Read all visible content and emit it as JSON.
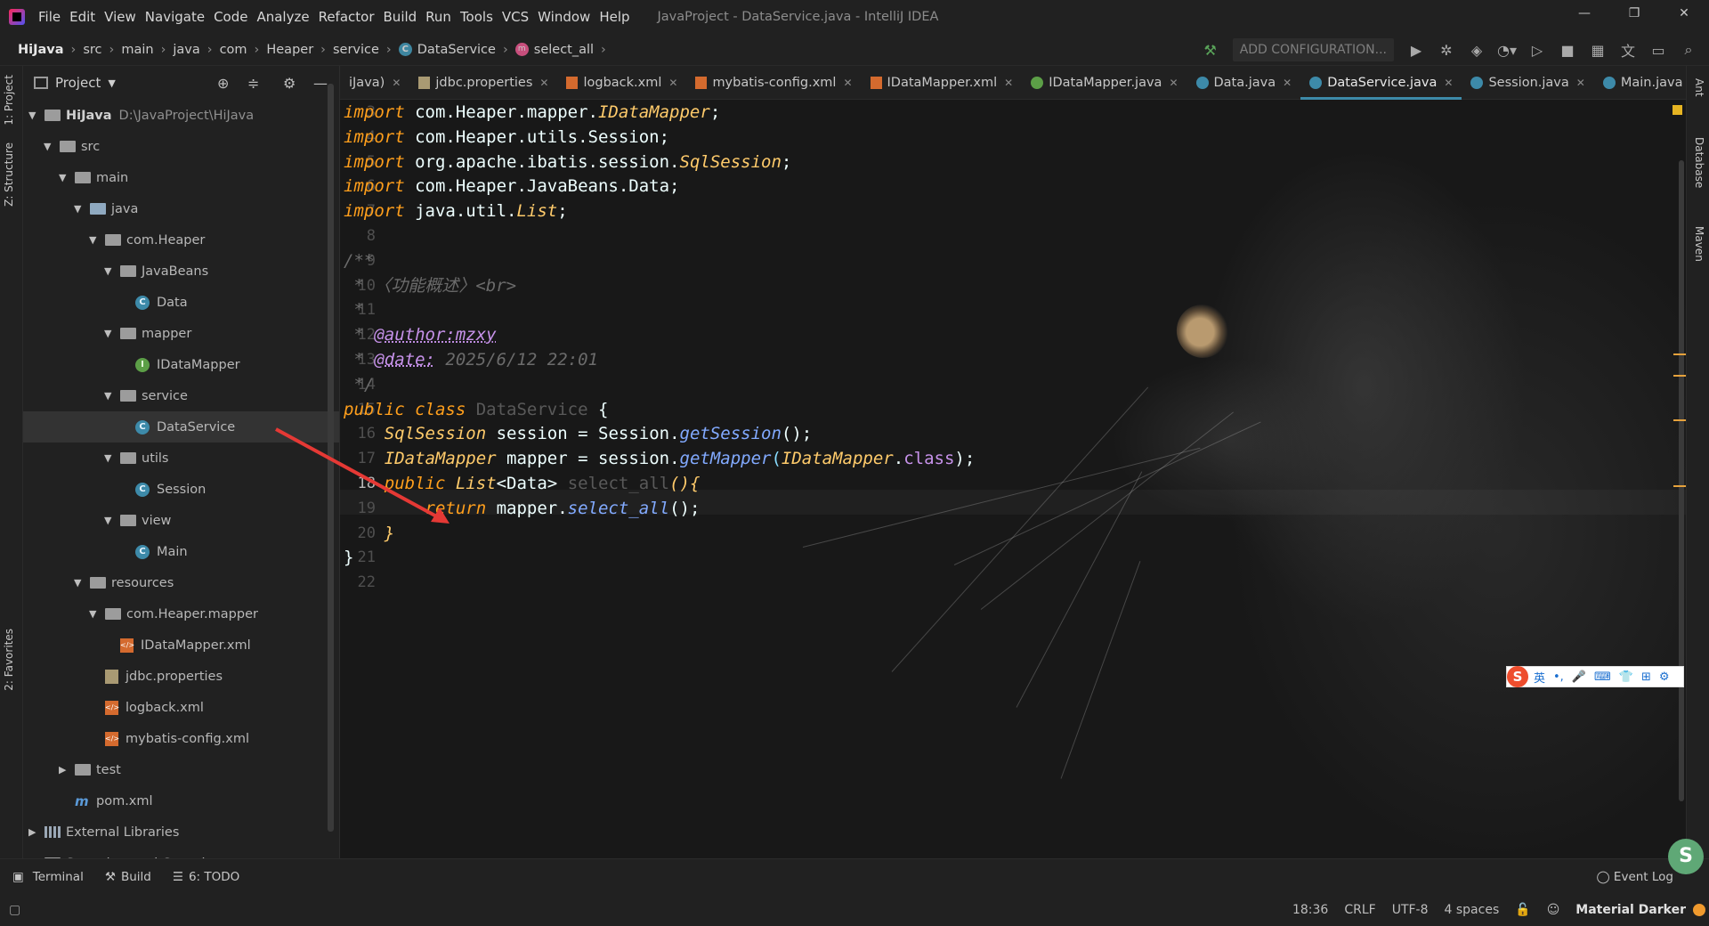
{
  "window": {
    "title": "JavaProject - DataService.java - IntelliJ IDEA",
    "controls": [
      "—",
      "❐",
      "✕"
    ]
  },
  "menu": [
    "File",
    "Edit",
    "View",
    "Navigate",
    "Code",
    "Analyze",
    "Refactor",
    "Build",
    "Run",
    "Tools",
    "VCS",
    "Window",
    "Help"
  ],
  "breadcrumbs": [
    "HiJava",
    "src",
    "main",
    "java",
    "com",
    "Heaper",
    "service",
    "DataService",
    "select_all"
  ],
  "toolbar": {
    "add_configuration": "ADD CONFIGURATION..."
  },
  "left_strip": {
    "project": "1: Project",
    "structure": "Z: Structure",
    "favorites": "2: Favorites"
  },
  "right_strip": {
    "ant": "Ant",
    "database": "Database",
    "maven": "Maven"
  },
  "project_panel": {
    "title": "Project",
    "tree": [
      {
        "label": "HiJava",
        "extra": "D:\\JavaProject\\HiJava",
        "icon": "module-folder-icon",
        "arrow": "▼"
      },
      {
        "label": "src",
        "icon": "folder-icon",
        "arrow": "▼"
      },
      {
        "label": "main",
        "icon": "folder-icon",
        "arrow": "▼"
      },
      {
        "label": "java",
        "icon": "source-folder-icon",
        "arrow": "▼"
      },
      {
        "label": "com.Heaper",
        "icon": "package-icon",
        "arrow": "▼"
      },
      {
        "label": "JavaBeans",
        "icon": "package-icon",
        "arrow": "▼"
      },
      {
        "label": "Data",
        "icon": "class-icon",
        "arrow": ""
      },
      {
        "label": "mapper",
        "icon": "package-icon",
        "arrow": "▼"
      },
      {
        "label": "IDataMapper",
        "icon": "interface-icon",
        "arrow": ""
      },
      {
        "label": "service",
        "icon": "package-icon",
        "arrow": "▼"
      },
      {
        "label": "DataService",
        "icon": "class-icon",
        "arrow": ""
      },
      {
        "label": "utils",
        "icon": "package-icon",
        "arrow": "▼"
      },
      {
        "label": "Session",
        "icon": "class-icon",
        "arrow": ""
      },
      {
        "label": "view",
        "icon": "package-icon",
        "arrow": "▼"
      },
      {
        "label": "Main",
        "icon": "class-icon",
        "arrow": ""
      },
      {
        "label": "resources",
        "icon": "resources-folder-icon",
        "arrow": "▼"
      },
      {
        "label": "com.Heaper.mapper",
        "icon": "folder-icon",
        "arrow": "▼"
      },
      {
        "label": "IDataMapper.xml",
        "icon": "xml-file-icon",
        "arrow": ""
      },
      {
        "label": "jdbc.properties",
        "icon": "properties-file-icon",
        "arrow": ""
      },
      {
        "label": "logback.xml",
        "icon": "xml-file-icon",
        "arrow": ""
      },
      {
        "label": "mybatis-config.xml",
        "icon": "xml-file-icon",
        "arrow": ""
      },
      {
        "label": "test",
        "icon": "folder-icon",
        "arrow": "▶"
      },
      {
        "label": "pom.xml",
        "icon": "maven-icon",
        "arrow": ""
      },
      {
        "label": "External Libraries",
        "icon": "library-icon",
        "arrow": "▶"
      },
      {
        "label": "Scratches and Consoles",
        "icon": "scratch-icon",
        "arrow": "▶"
      }
    ]
  },
  "tabs": [
    {
      "label": "iJava)",
      "icon": "none"
    },
    {
      "label": "jdbc.properties",
      "icon": "properties"
    },
    {
      "label": "logback.xml",
      "icon": "xml"
    },
    {
      "label": "mybatis-config.xml",
      "icon": "xml"
    },
    {
      "label": "IDataMapper.xml",
      "icon": "xml"
    },
    {
      "label": "IDataMapper.java",
      "icon": "interface"
    },
    {
      "label": "Data.java",
      "icon": "class"
    },
    {
      "label": "DataService.java",
      "icon": "class",
      "active": true
    },
    {
      "label": "Session.java",
      "icon": "class"
    },
    {
      "label": "Main.java",
      "icon": "class"
    }
  ],
  "editor": {
    "line_numbers": [
      "3",
      "4",
      "5",
      "6",
      "7",
      "8",
      "9",
      "10",
      "11",
      "12",
      "13",
      "14",
      "15",
      "16",
      "17",
      "18",
      "19",
      "20",
      "21",
      "22"
    ],
    "current_line": "18",
    "lines": [
      [
        {
          "t": "import ",
          "c": "kw"
        },
        {
          "t": "com.Heaper.mapper.",
          "c": "pk"
        },
        {
          "t": "IDataMapper",
          "c": "ty"
        },
        {
          "t": ";",
          "c": "pk"
        }
      ],
      [
        {
          "t": "import ",
          "c": "kw"
        },
        {
          "t": "com.Heaper.utils.Session;",
          "c": "pk"
        }
      ],
      [
        {
          "t": "import ",
          "c": "kw"
        },
        {
          "t": "org.apache.ibatis.session.",
          "c": "pk"
        },
        {
          "t": "SqlSession",
          "c": "ty"
        },
        {
          "t": ";",
          "c": "pk"
        }
      ],
      [
        {
          "t": "import ",
          "c": "kw"
        },
        {
          "t": "com.Heaper.JavaBeans.Data;",
          "c": "pk"
        }
      ],
      [
        {
          "t": "import ",
          "c": "kw"
        },
        {
          "t": "java.util.",
          "c": "pk"
        },
        {
          "t": "List",
          "c": "ty"
        },
        {
          "t": ";",
          "c": "pk"
        }
      ],
      [],
      [
        {
          "t": "/**",
          "c": "cm"
        }
      ],
      [
        {
          "t": " * ",
          "c": "cm"
        },
        {
          "t": "〈功能概述〉<br>",
          "c": "cm"
        }
      ],
      [
        {
          "t": " *",
          "c": "cm"
        }
      ],
      [
        {
          "t": " * ",
          "c": "cm"
        },
        {
          "t": "@author:mzxy",
          "c": "tag"
        }
      ],
      [
        {
          "t": " * ",
          "c": "cm"
        },
        {
          "t": "@date:",
          "c": "tag"
        },
        {
          "t": " 2025/6/12 22:01",
          "c": "cm"
        }
      ],
      [
        {
          "t": " */",
          "c": "cm"
        }
      ],
      [
        {
          "t": "public ",
          "c": "kw"
        },
        {
          "t": "class ",
          "c": "kw"
        },
        {
          "t": "DataService ",
          "c": "dim"
        },
        {
          "t": "{",
          "c": "pk"
        }
      ],
      [
        {
          "t": "    ",
          "c": "pk"
        },
        {
          "t": "SqlSession ",
          "c": "ty"
        },
        {
          "t": "session = ",
          "c": "pk"
        },
        {
          "t": "Session.",
          "c": "pk"
        },
        {
          "t": "getSession",
          "c": "fn"
        },
        {
          "t": "();",
          "c": "pk"
        }
      ],
      [
        {
          "t": "    ",
          "c": "pk"
        },
        {
          "t": "IDataMapper ",
          "c": "ty"
        },
        {
          "t": "mapper = session.",
          "c": "pk"
        },
        {
          "t": "getMapper",
          "c": "fn"
        },
        {
          "t": "(",
          "c": "pu"
        },
        {
          "t": "IDataMapper",
          "c": "ty"
        },
        {
          "t": ".",
          "c": "pk"
        },
        {
          "t": "class",
          "c": "kw2"
        },
        {
          "t": ");",
          "c": "pk"
        }
      ],
      [
        {
          "t": "    ",
          "c": "pk"
        },
        {
          "t": "public ",
          "c": "kw"
        },
        {
          "t": "List",
          "c": "ty"
        },
        {
          "t": "<Data> ",
          "c": "pk"
        },
        {
          "t": "select_all",
          "c": "dim"
        },
        {
          "t": "(){",
          "c": "ty"
        }
      ],
      [
        {
          "t": "        ",
          "c": "pk"
        },
        {
          "t": "return ",
          "c": "kw"
        },
        {
          "t": "mapper.",
          "c": "pk"
        },
        {
          "t": "select_all",
          "c": "fn"
        },
        {
          "t": "();",
          "c": "pk"
        }
      ],
      [
        {
          "t": "    ",
          "c": "pk"
        },
        {
          "t": "}",
          "c": "ty"
        }
      ],
      [
        {
          "t": "}",
          "c": "pk"
        }
      ],
      []
    ]
  },
  "ime_bar": {
    "logo": "S",
    "items": [
      "英",
      "•,",
      "🎤",
      "⌨",
      "👕",
      "⊞",
      "⚙"
    ]
  },
  "bottom_tools": {
    "terminal": "Terminal",
    "build": "Build",
    "todo": "6: TODO",
    "event_log": "Event Log"
  },
  "status": {
    "position": "18:36",
    "line_sep": "CRLF",
    "encoding": "UTF-8",
    "indent": "4 spaces",
    "theme": "Material Darker"
  },
  "colors": {
    "accent": "#3d8aa9",
    "keyword": "#ff9f1c",
    "type": "#ffcb6b",
    "function": "#82aaff",
    "arrow": "#e53935"
  }
}
